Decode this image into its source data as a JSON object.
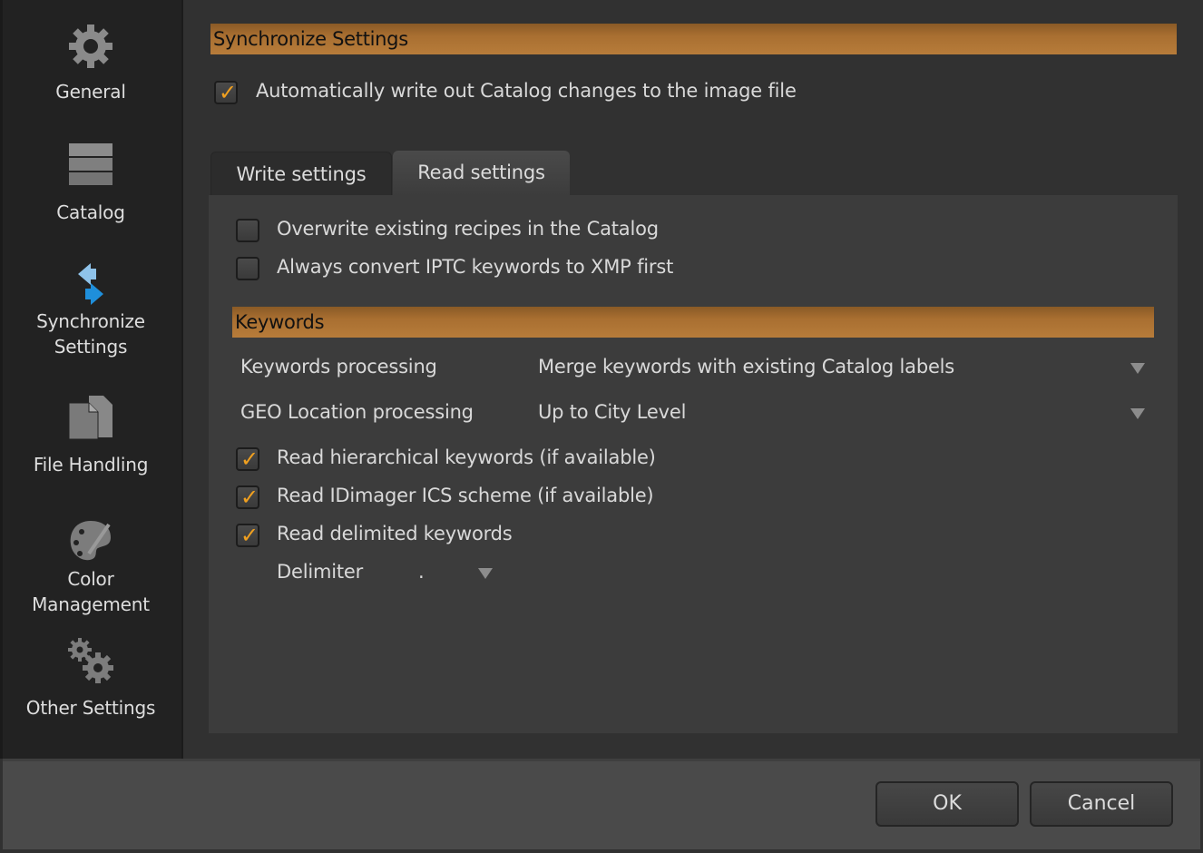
{
  "sidebar": {
    "items": [
      {
        "label": "General",
        "icon": "gear-icon"
      },
      {
        "label": "Catalog",
        "icon": "stack-icon"
      },
      {
        "label_line1": "Synchronize",
        "label_line2": "Settings",
        "icon": "sync-arrows-icon",
        "selected": true
      },
      {
        "label": "File Handling",
        "icon": "files-icon"
      },
      {
        "label_line1": "Color",
        "label_line2": "Management",
        "icon": "palette-icon"
      },
      {
        "label": "Other Settings",
        "icon": "gears-icon"
      }
    ]
  },
  "main": {
    "section_title": "Synchronize Settings",
    "auto_write": {
      "label": "Automatically write out Catalog changes to the image file",
      "checked": true
    },
    "tabs": [
      {
        "label": "Write settings",
        "active": false
      },
      {
        "label": "Read settings",
        "active": true
      }
    ],
    "read_settings": {
      "options": [
        {
          "label": "Overwrite existing recipes in the Catalog",
          "checked": false
        },
        {
          "label": "Always convert IPTC keywords to XMP first",
          "checked": false
        }
      ],
      "keywords_section_title": "Keywords",
      "keywords_processing": {
        "label": "Keywords processing",
        "value": "Merge keywords with existing Catalog labels"
      },
      "geo_processing": {
        "label": "GEO Location processing",
        "value": "Up to City Level"
      },
      "keyword_options": [
        {
          "label": "Read hierarchical keywords (if available)",
          "checked": true
        },
        {
          "label": "Read IDimager ICS scheme (if available)",
          "checked": true
        },
        {
          "label": "Read delimited keywords",
          "checked": true
        }
      ],
      "delimiter": {
        "label": "Delimiter",
        "value": "."
      }
    }
  },
  "footer": {
    "ok_label": "OK",
    "cancel_label": "Cancel"
  },
  "colors": {
    "accent_bar": "#a96f31",
    "checkmark": "#f0a020",
    "sync_icon": "#2a9be0"
  },
  "checkmark_glyph": "✓"
}
